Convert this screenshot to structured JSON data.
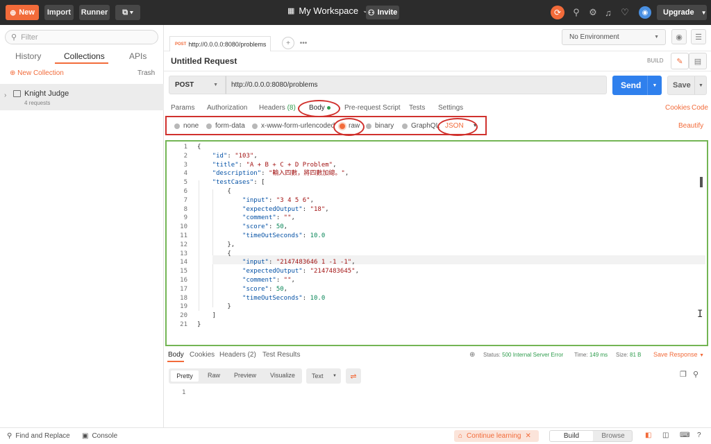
{
  "topbar": {
    "new_label": "New",
    "import_label": "Import",
    "runner_label": "Runner",
    "workspace_label": "My Workspace",
    "invite_label": "Invite",
    "upgrade_label": "Upgrade"
  },
  "sidebar": {
    "filter_placeholder": "Filter",
    "tabs": [
      "History",
      "Collections",
      "APIs"
    ],
    "active_tab": "Collections",
    "new_collection": "New Collection",
    "trash": "Trash",
    "collection": {
      "name": "Knight Judge",
      "count": "4 requests"
    }
  },
  "request_tab": {
    "method": "POST",
    "url": "http://0.0.0.0:8080/problems"
  },
  "environment": {
    "selected": "No Environment"
  },
  "request": {
    "title": "Untitled Request",
    "build_label": "BUILD",
    "method": "POST",
    "url": "http://0.0.0.0:8080/problems",
    "send_label": "Send",
    "save_label": "Save"
  },
  "request_tabs": {
    "params": "Params",
    "authorization": "Authorization",
    "headers": "Headers",
    "headers_count": "(8)",
    "body": "Body",
    "prerequest": "Pre-request Script",
    "tests": "Tests",
    "settings": "Settings",
    "cookies": "Cookies",
    "code": "Code"
  },
  "body_types": {
    "none": "none",
    "form_data": "form-data",
    "urlencoded": "x-www-form-urlencoded",
    "raw": "raw",
    "binary": "binary",
    "graphql": "GraphQL",
    "format": "JSON",
    "beautify": "Beautify"
  },
  "editor": {
    "lines": [
      "1",
      "2",
      "3",
      "4",
      "5",
      "6",
      "7",
      "8",
      "9",
      "10",
      "11",
      "12",
      "13",
      "14",
      "15",
      "16",
      "17",
      "18",
      "19",
      "20",
      "21"
    ],
    "code": [
      "{",
      "    \"id\": \"103\",",
      "    \"title\": \"A + B + C + D Problem\",",
      "    \"description\": \"輸入四數，將四數加總。\",",
      "    \"testCases\": [",
      "        {",
      "            \"input\": \"3 4 5 6\",",
      "            \"expectedOutput\": \"18\",",
      "            \"comment\": \"\",",
      "            \"score\": 50,",
      "            \"timeOutSeconds\": 10.0",
      "        },",
      "        {",
      "            \"input\": \"2147483646 1 -1 -1\",",
      "            \"expectedOutput\": \"2147483645\",",
      "            \"comment\": \"\",",
      "            \"score\": 50,",
      "            \"timeOutSeconds\": 10.0",
      "        }",
      "    ]",
      "}"
    ]
  },
  "response": {
    "tabs": {
      "body": "Body",
      "cookies": "Cookies",
      "headers": "Headers",
      "headers_count": "(2)",
      "test_results": "Test Results"
    },
    "status_label": "Status:",
    "status_value": "500 Internal Server Error",
    "time_label": "Time:",
    "time_value": "149 ms",
    "size_label": "Size:",
    "size_value": "81 B",
    "save_response": "Save Response",
    "views": {
      "pretty": "Pretty",
      "raw": "Raw",
      "preview": "Preview",
      "visualize": "Visualize"
    },
    "format": "Text",
    "line": "1"
  },
  "statusbar": {
    "find_replace": "Find and Replace",
    "console": "Console",
    "continue_learning": "Continue learning",
    "build": "Build",
    "browse": "Browse"
  },
  "colors": {
    "accent": "#f26b3a",
    "send": "#2f80ed",
    "annotation_red": "#d0312d",
    "annotation_green": "#73b554"
  }
}
